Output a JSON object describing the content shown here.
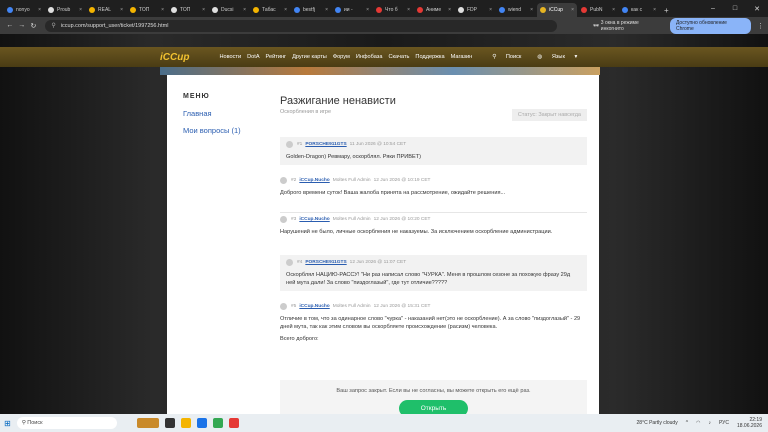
{
  "browser": {
    "tabs": [
      {
        "label": "nonyo",
        "color": "#4285f4"
      },
      {
        "label": "Proub",
        "color": "#e0e0e0"
      },
      {
        "label": "REAL",
        "color": "#f4b400"
      },
      {
        "label": "ТОП",
        "color": "#f4b400"
      },
      {
        "label": "ТОП",
        "color": "#e0e0e0"
      },
      {
        "label": "Ducsi",
        "color": "#e0e0e0"
      },
      {
        "label": "Табас",
        "color": "#f4b400"
      },
      {
        "label": "bestfj",
        "color": "#4285f4"
      },
      {
        "label": "ии - ",
        "color": "#4285f4"
      },
      {
        "label": "Что б",
        "color": "#e53935"
      },
      {
        "label": "Аниме",
        "color": "#e53935"
      },
      {
        "label": "FDP",
        "color": "#e0e0e0"
      },
      {
        "label": "wiend",
        "color": "#4285f4"
      },
      {
        "label": "iCCup",
        "color": "#e6b422",
        "active": true
      },
      {
        "label": "PubN",
        "color": "#e53935"
      },
      {
        "label": "как с",
        "color": "#4285f4"
      }
    ],
    "url": "iccup.com/support_user/ticket/1997256.html",
    "incognito_label": "3 окна в режиме инкогнито",
    "update_label": "Доступно обновление Chrome"
  },
  "site": {
    "logo": "iCCup",
    "nav": [
      "Новости",
      "DotA",
      "Рейтинг",
      "Другие карты",
      "Форум",
      "Инфобаза",
      "Скачать",
      "Поддержка",
      "Магазин"
    ],
    "search_label": "Поиск",
    "language_label": "Язык"
  },
  "sidebar": {
    "title": "МЕНЮ",
    "items": [
      "Главная",
      "Мои вопросы (1)"
    ]
  },
  "ticket": {
    "title": "Разжигание ненависти",
    "subtitle": "Оскорбления в игре",
    "status": "Статус: Закрыт навсегда"
  },
  "messages": [
    {
      "num": "#1",
      "author": "PORSCHE911GTS",
      "role": "",
      "time": "11 Jun 2026 @ 10:54 CET",
      "text": "Golden-Dragon) Ревмару, оскорблял. Ряки ПРИВЕТ)"
    },
    {
      "num": "#2",
      "author": "iCCup.Nucho",
      "role": "Moltes Full Admin",
      "time": "12 Jun 2026 @ 10:19 CET",
      "text": "Доброго времени суток! Ваша жалоба принята на рассмотрение, ожидайте решения..."
    },
    {
      "num": "#3",
      "author": "iCCup.Nucho",
      "role": "Moltes Full Admin",
      "time": "12 Jun 2026 @ 10:20 CET",
      "text": "Нарушений не было, личные оскорбления не наказуемы. За исключением оскорбление администрации."
    },
    {
      "num": "#4",
      "author": "PORSCHE911GTS",
      "role": "",
      "time": "12 Jun 2026 @ 11:07 CET",
      "text": "Оскорблял НАЦИЮ-РАССУ! \"Ни раз написал слово \"ЧУРКА\". Меня в прошлом сезоне за похожую фразу 29д ней мута дали! За слово \"пиздоглазый\", где тут отличие?????"
    },
    {
      "num": "#5",
      "author": "iCCup.Nucho",
      "role": "Moltes Full Admin",
      "time": "12 Jun 2026 @ 15:31 CET",
      "text": "Отличие в том, что за одинарное слово \"чурка\" - наказаний нет(это не оскорбление). А за слово \"пиздоглазый\" - 29 дней мута, так как этим словом вы оскорбляете происхождение (расизм) человека.",
      "text2": "Всего доброго:"
    }
  ],
  "closed": {
    "text": "Ваш запрос закрыт. Если вы не согласны, вы можете открыть его ещё раз.",
    "button": "Открыть"
  },
  "taskbar": {
    "search_placeholder": "Поиск",
    "weather": "28°C  Partly cloudy",
    "lang": "РУС",
    "time": "22:19",
    "date": "18.06.2026"
  }
}
